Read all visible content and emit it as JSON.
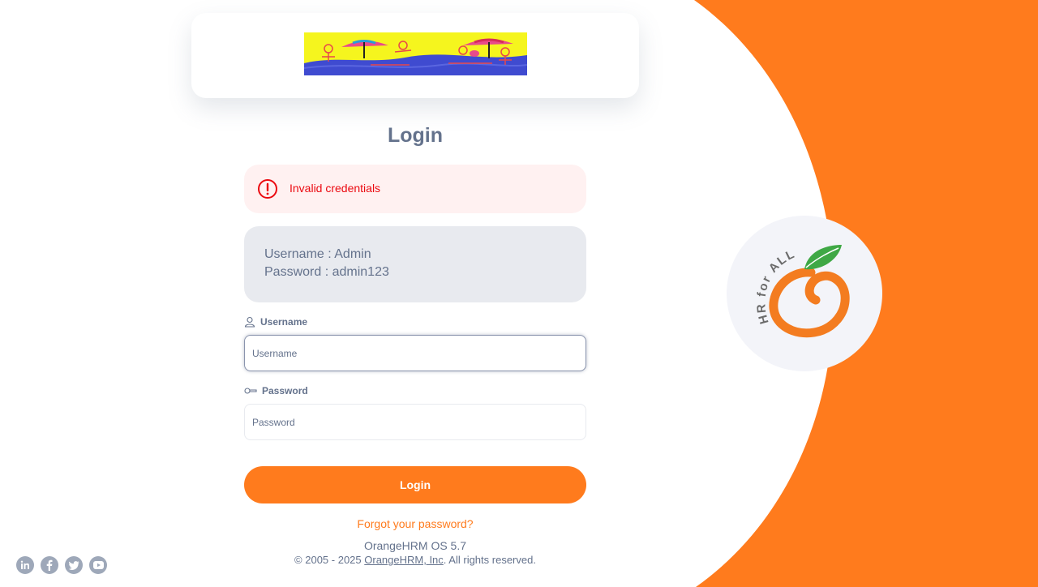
{
  "title": "Login",
  "alert": {
    "message": "Invalid credentials",
    "icon": "alert-circle-icon",
    "color": "#eb0910"
  },
  "credentials": {
    "username_line": "Username : Admin",
    "password_line": "Password : admin123"
  },
  "form": {
    "username_label": "Username",
    "username_placeholder": "Username",
    "password_label": "Password",
    "password_placeholder": "Password",
    "login_button": "Login",
    "forgot_password": "Forgot your password?"
  },
  "footer": {
    "version": "OrangeHRM OS 5.7",
    "copyright_prefix": "© 2005 - 2025 ",
    "company_link": "OrangeHRM, Inc",
    "copyright_suffix": ". All rights reserved."
  },
  "social": [
    "linkedin-icon",
    "facebook-icon",
    "twitter-icon",
    "youtube-icon"
  ],
  "brand": {
    "tagline": "HR for ALL"
  },
  "colors": {
    "accent": "#ff7b1d",
    "text": "#64728c",
    "error": "#eb0910",
    "leaf": "#3fa845"
  }
}
